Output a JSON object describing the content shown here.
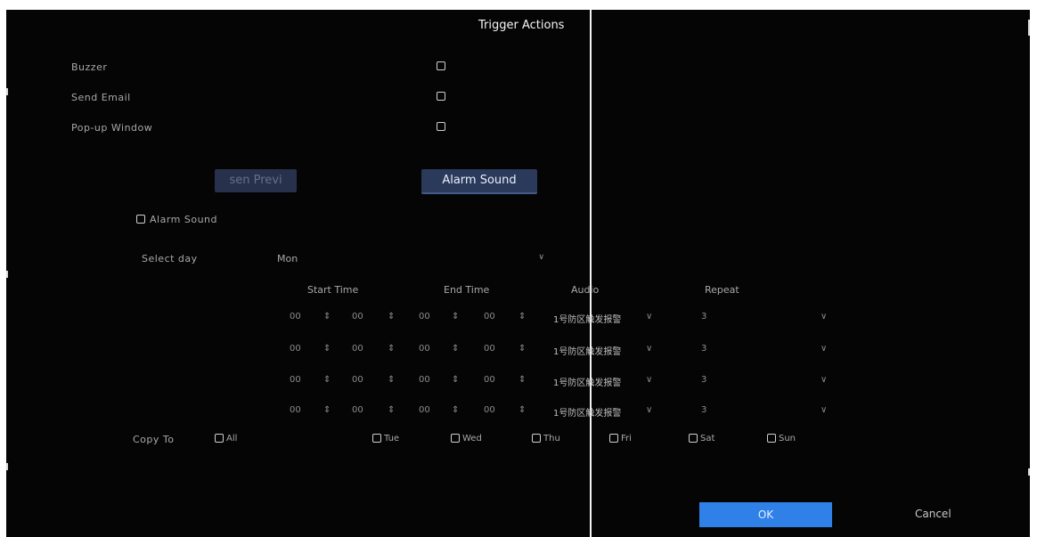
{
  "dialog": {
    "title": "Trigger Actions"
  },
  "options": [
    {
      "label": "Buzzer",
      "checked": false
    },
    {
      "label": "Send Email",
      "checked": false
    },
    {
      "label": "Pop-up Window",
      "checked": false
    }
  ],
  "buttons": {
    "preview_label": "sen  Previ",
    "alarm_sound_label": "Alarm Sound",
    "ok_label": "OK",
    "cancel_label": "Cancel"
  },
  "alarm_sound_checkbox": {
    "label": "Alarm Sound",
    "checked": false
  },
  "select_day": {
    "label": "Select day",
    "value": "Mon"
  },
  "table": {
    "headers": [
      "Start Time",
      "End Time",
      "Audio",
      "Repeat"
    ],
    "rows": [
      {
        "start_h": "00",
        "start_m": "00",
        "end_h": "00",
        "end_m": "00",
        "audio": "1号防区触发报警",
        "repeat": "3"
      },
      {
        "start_h": "00",
        "start_m": "00",
        "end_h": "00",
        "end_m": "00",
        "audio": "1号防区触发报警",
        "repeat": "3"
      },
      {
        "start_h": "00",
        "start_m": "00",
        "end_h": "00",
        "end_m": "00",
        "audio": "1号防区触发报警",
        "repeat": "3"
      },
      {
        "start_h": "00",
        "start_m": "00",
        "end_h": "00",
        "end_m": "00",
        "audio": "1号防区触发报警",
        "repeat": "3"
      }
    ]
  },
  "copy_to": {
    "label": "Copy To",
    "days": [
      "All",
      "Tue",
      "Wed",
      "Thu",
      "Fri",
      "Sat",
      "Sun"
    ]
  },
  "icons": {
    "checkbox": "checkbox-icon",
    "chevron": "chevron-down-icon",
    "spinner": "spinner-icon"
  }
}
